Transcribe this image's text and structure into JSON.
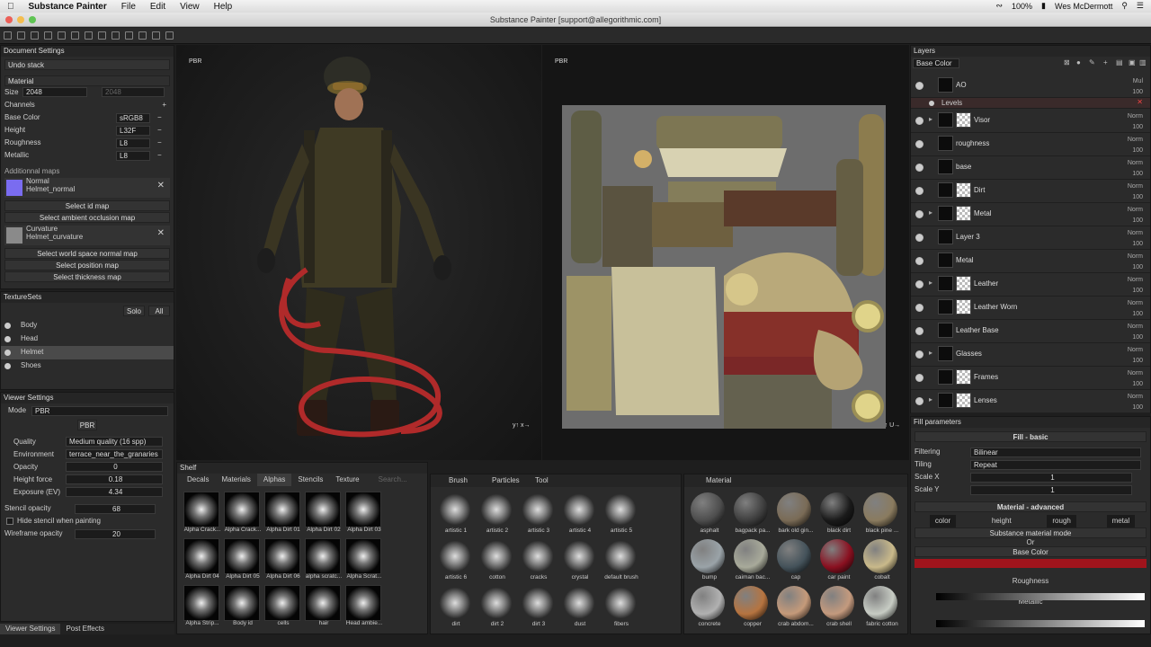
{
  "menubar": {
    "app": "Substance Painter",
    "items": [
      "File",
      "Edit",
      "View",
      "Help"
    ],
    "battery": "100%",
    "user": "Wes McDermott"
  },
  "window": {
    "title": "Substance Painter [support@allegorithmic.com]"
  },
  "document_settings": {
    "header": "Document Settings",
    "undo": "Undo stack",
    "material": "Material",
    "size_label": "Size",
    "size_value": "2048",
    "size_value2": "2048",
    "channels_label": "Channels",
    "channels": [
      {
        "name": "Base Color",
        "format": "sRGB8"
      },
      {
        "name": "Height",
        "format": "L32F"
      },
      {
        "name": "Roughness",
        "format": "L8"
      },
      {
        "name": "Metallic",
        "format": "L8"
      }
    ],
    "additional_label": "Additionnal maps",
    "normal": {
      "title": "Normal",
      "file": "Helmet_normal"
    },
    "curvature": {
      "title": "Curvature",
      "file": "Helmet_curvature"
    },
    "buttons": [
      "Select id map",
      "Select ambient occlusion map",
      "Select world space normal map",
      "Select position map",
      "Select thickness map"
    ]
  },
  "texturesets": {
    "header": "TextureSets",
    "solo": "Solo",
    "all": "All",
    "items": [
      "Body",
      "Head",
      "Helmet",
      "Shoes"
    ],
    "selected": "Helmet"
  },
  "viewer_settings": {
    "header": "Viewer Settings",
    "mode_label": "Mode",
    "mode_value": "PBR",
    "pbr_btn": "PBR",
    "rows": [
      {
        "label": "Quality",
        "value": "Medium quality (16 spp)"
      },
      {
        "label": "Environment",
        "value": "terrace_near_the_granaries"
      },
      {
        "label": "Opacity",
        "value": "0"
      },
      {
        "label": "Height force",
        "value": "0.18"
      },
      {
        "label": "Exposure (EV)",
        "value": "4.34"
      }
    ],
    "stencil_label": "Stencil opacity",
    "stencil_value": "68",
    "hide_stencil": "Hide stencil when painting",
    "wire_label": "Wireframe opacity",
    "wire_value": "20",
    "tabs": [
      "Viewer Settings",
      "Post Effects"
    ]
  },
  "viewport": {
    "left_label": "PBR",
    "right_label": "PBR"
  },
  "layers": {
    "header": "Layers",
    "channel": "Base Color",
    "items": [
      {
        "name": "AO",
        "blend": "Mul",
        "opacity": "100",
        "checker": false,
        "folder": false
      },
      {
        "name": "Levels",
        "blend": "",
        "opacity": "",
        "checker": false,
        "folder": false,
        "effect": true
      },
      {
        "name": "Visor",
        "blend": "Norm",
        "opacity": "100",
        "checker": true,
        "folder": true
      },
      {
        "name": "roughness",
        "blend": "Norm",
        "opacity": "100",
        "checker": false,
        "folder": false
      },
      {
        "name": "base",
        "blend": "Norm",
        "opacity": "100",
        "checker": false,
        "folder": false
      },
      {
        "name": "Dirt",
        "blend": "Norm",
        "opacity": "100",
        "checker": true,
        "folder": false
      },
      {
        "name": "Metal",
        "blend": "Norm",
        "opacity": "100",
        "checker": true,
        "folder": true
      },
      {
        "name": "Layer 3",
        "blend": "Norm",
        "opacity": "100",
        "checker": false,
        "folder": false
      },
      {
        "name": "Metal",
        "blend": "Norm",
        "opacity": "100",
        "checker": false,
        "folder": false
      },
      {
        "name": "Leather",
        "blend": "Norm",
        "opacity": "100",
        "checker": true,
        "folder": true
      },
      {
        "name": "Leather Worn",
        "blend": "Norm",
        "opacity": "100",
        "checker": true,
        "folder": false
      },
      {
        "name": "Leather Base",
        "blend": "Norm",
        "opacity": "100",
        "checker": false,
        "folder": false
      },
      {
        "name": "Glasses",
        "blend": "Norm",
        "opacity": "100",
        "checker": false,
        "folder": true
      },
      {
        "name": "Frames",
        "blend": "Norm",
        "opacity": "100",
        "checker": true,
        "folder": false
      },
      {
        "name": "Lenses",
        "blend": "Norm",
        "opacity": "100",
        "checker": true,
        "folder": true
      }
    ]
  },
  "fill": {
    "header": "Fill parameters",
    "basic": "Fill - basic",
    "filtering_label": "Filtering",
    "filtering": "Bilinear",
    "tiling_label": "Tiling",
    "tiling": "Repeat",
    "scalex_label": "Scale X",
    "scalex": "1",
    "scaley_label": "Scale Y",
    "scaley": "1",
    "advanced": "Material - advanced",
    "chips": [
      "color",
      "height",
      "rough",
      "metal"
    ],
    "mode": "Substance material mode",
    "or": "Or",
    "basecolor": "Base Color",
    "basecolor_hex": "#a0141c",
    "roughness": "Roughness",
    "metallic": "Metallic",
    "ticks": [
      "0",
      "0.1",
      "0.2",
      "0.3",
      "0.4",
      "0.5",
      "0.6",
      "0.7",
      "0.8",
      "0.9",
      "1"
    ]
  },
  "shelf": {
    "header": "Shelf",
    "tabs": [
      "Decals",
      "Materials",
      "Alphas",
      "Stencils",
      "Texture"
    ],
    "active": "Alphas",
    "search": "Search...",
    "alphas": [
      "Alpha Crack...",
      "Alpha Crack...",
      "Alpha Dirt 01",
      "Alpha Dirt 02",
      "Alpha Dirt 03",
      "Alpha Dirt 04",
      "Alpha Dirt 05",
      "Alpha Dirt 06",
      "alpha scratc...",
      "Alpha Scrat...",
      "Alpha Strip...",
      "Body id",
      "cells",
      "hair",
      "Head ambie..."
    ],
    "brush_tabs": [
      "Brush",
      "Particles",
      "Tool"
    ],
    "brushes": [
      "artistic 1",
      "artistic 2",
      "artistic 3",
      "artistic 4",
      "artistic 5",
      "artistic 6",
      "cotton",
      "cracks",
      "crystal",
      "default brush",
      "dirt",
      "dirt 2",
      "dirt 3",
      "dust",
      "fibers"
    ],
    "material_tab": "Material",
    "materials": [
      "asphalt",
      "bagpack pa...",
      "bark old gin...",
      "black dirt",
      "black pine ...",
      "bump",
      "caiman bac...",
      "cap",
      "car paint",
      "cobalt",
      "concrete",
      "copper",
      "crab abdom...",
      "crab shell",
      "fabric cotton"
    ]
  }
}
